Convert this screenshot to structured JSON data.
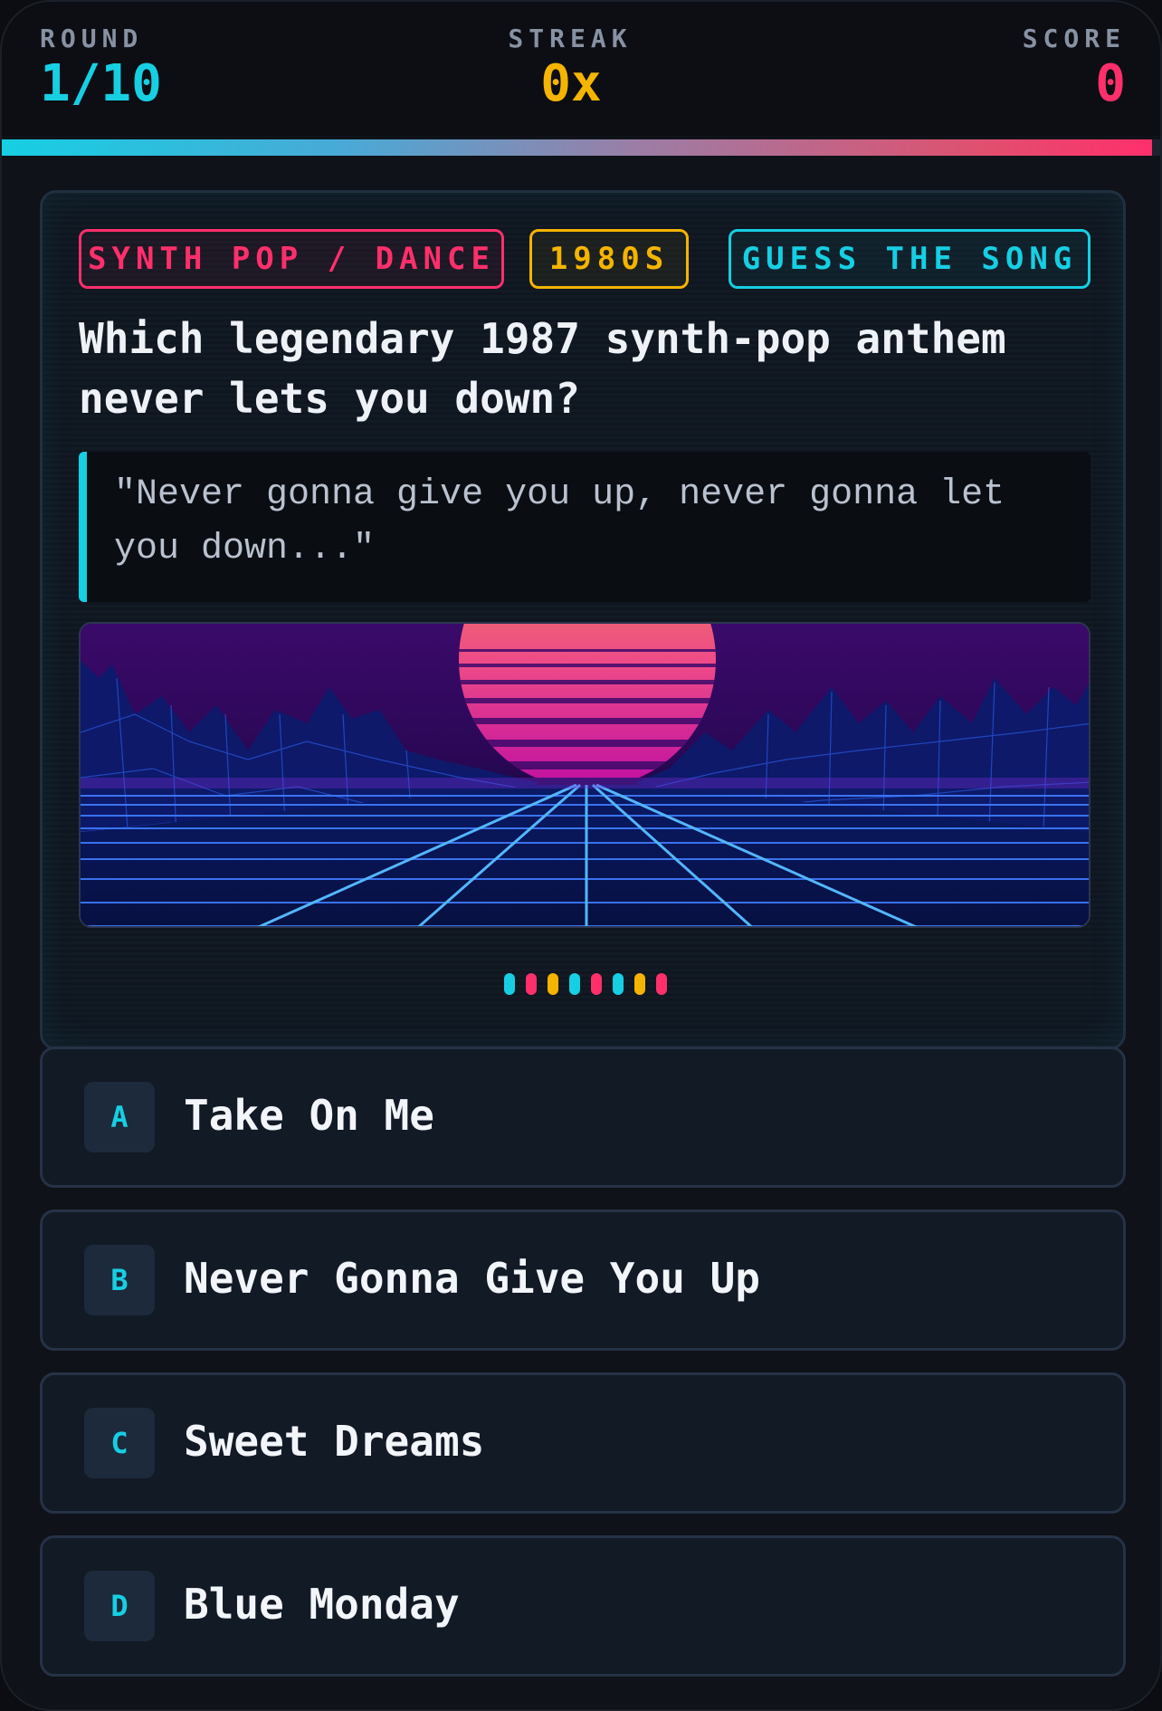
{
  "header": {
    "round_label": "ROUND",
    "round_value": "1/10",
    "streak_label": "STREAK",
    "streak_value": "0x",
    "score_label": "SCORE",
    "score_value": "0",
    "progress_fraction": 0.99
  },
  "tags": {
    "genre": "SYNTH POP / DANCE",
    "decade": "1980S",
    "mode": "GUESS THE SONG"
  },
  "question": {
    "text": "Which legendary 1987 synth-pop anthem never lets you down?",
    "lyric": "\"Never gonna give you up, never gonna let you down...\""
  },
  "equalizer_colors": [
    "#16cfe3",
    "#ff2f6b",
    "#f5b400",
    "#16cfe3",
    "#ff2f6b",
    "#16cfe3",
    "#f5b400",
    "#ff2f6b"
  ],
  "answers": [
    {
      "letter": "A",
      "text": "Take On Me"
    },
    {
      "letter": "B",
      "text": "Never Gonna Give You Up"
    },
    {
      "letter": "C",
      "text": "Sweet Dreams"
    },
    {
      "letter": "D",
      "text": "Blue Monday"
    }
  ],
  "colors": {
    "accent_cyan": "#16cfe3",
    "accent_yellow": "#f5b400",
    "accent_pink": "#ff2f6b"
  }
}
